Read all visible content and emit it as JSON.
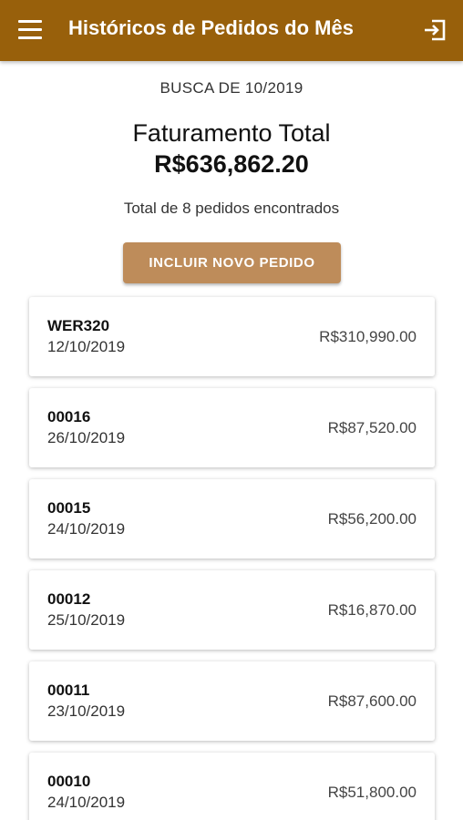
{
  "header": {
    "title": "Históricos de Pedidos do Mês",
    "menu_icon": "hamburger-menu-icon",
    "exit_icon": "exit-icon",
    "color": "#98600b"
  },
  "summary": {
    "search_label": "BUSCA DE 10/2019",
    "total_title": "Faturamento Total",
    "total_value": "R$636,862.20",
    "count_label": "Total de 8 pedidos encontrados"
  },
  "actions": {
    "add_order_label": "INCLUIR NOVO PEDIDO",
    "button_color": "#be8c5a"
  },
  "orders": [
    {
      "code": "WER320",
      "date": "12/10/2019",
      "amount": "R$310,990.00"
    },
    {
      "code": "00016",
      "date": "26/10/2019",
      "amount": "R$87,520.00"
    },
    {
      "code": "00015",
      "date": "24/10/2019",
      "amount": "R$56,200.00"
    },
    {
      "code": "00012",
      "date": "25/10/2019",
      "amount": "R$16,870.00"
    },
    {
      "code": "00011",
      "date": "23/10/2019",
      "amount": "R$87,600.00"
    },
    {
      "code": "00010",
      "date": "24/10/2019",
      "amount": "R$51,800.00"
    }
  ]
}
